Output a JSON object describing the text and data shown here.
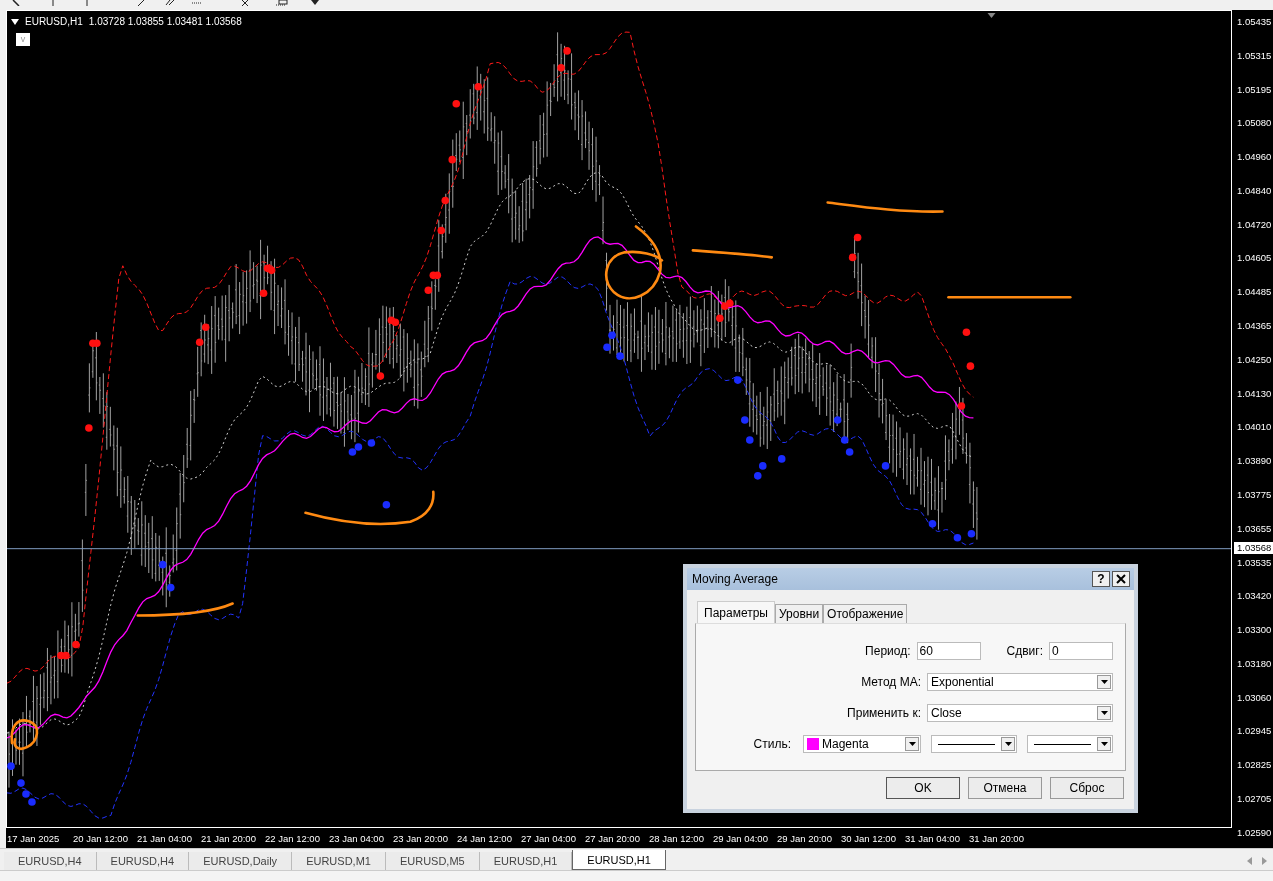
{
  "chart": {
    "symbol": "EURUSD,H1",
    "ohlc": "1.03728 1.03855 1.03481 1.03568",
    "marker_box": "v",
    "price_axis": [
      "1.05435",
      "1.05315",
      "1.05195",
      "1.05080",
      "1.04960",
      "1.04840",
      "1.04720",
      "1.04605",
      "1.04485",
      "1.04365",
      "1.04250",
      "1.04130",
      "1.04010",
      "1.03890",
      "1.03775",
      "1.03655",
      "1.03535",
      "1.03420",
      "1.03300",
      "1.03180",
      "1.03060",
      "1.02945",
      "1.02825",
      "1.02705",
      "1.02590"
    ],
    "current_price": "1.03568",
    "time_axis": [
      "17 Jan 2025",
      "20 Jan 12:00",
      "21 Jan 04:00",
      "21 Jan 20:00",
      "22 Jan 12:00",
      "23 Jan 04:00",
      "23 Jan 20:00",
      "24 Jan 12:00",
      "27 Jan 04:00",
      "27 Jan 20:00",
      "28 Jan 12:00",
      "29 Jan 04:00",
      "29 Jan 20:00",
      "30 Jan 12:00",
      "31 Jan 04:00",
      "31 Jan 20:00"
    ]
  },
  "tabs": [
    {
      "label": "EURUSD,H4",
      "selected": false
    },
    {
      "label": "EURUSD,H4",
      "selected": false
    },
    {
      "label": "EURUSD,Daily",
      "selected": false
    },
    {
      "label": "EURUSD,M1",
      "selected": false
    },
    {
      "label": "EURUSD,M5",
      "selected": false
    },
    {
      "label": "EURUSD,H1",
      "selected": false
    },
    {
      "label": "EURUSD,H1",
      "selected": true
    }
  ],
  "dialog": {
    "title": "Moving Average",
    "help": "?",
    "tabs": [
      {
        "label": "Параметры",
        "selected": true
      },
      {
        "label": "Уровни",
        "selected": false
      },
      {
        "label": "Отображение",
        "selected": false
      }
    ],
    "period": {
      "label": "Период:",
      "value": "60"
    },
    "shift": {
      "label": "Сдвиг:",
      "value": "0"
    },
    "method": {
      "label": "Метод MA:",
      "value": "Exponential"
    },
    "apply": {
      "label": "Применить к:",
      "value": "Close"
    },
    "style": {
      "label": "Стиль:",
      "color_name": "Magenta",
      "color": "#ff00ff"
    },
    "buttons": [
      "OK",
      "Отмена",
      "Сброс"
    ]
  }
}
